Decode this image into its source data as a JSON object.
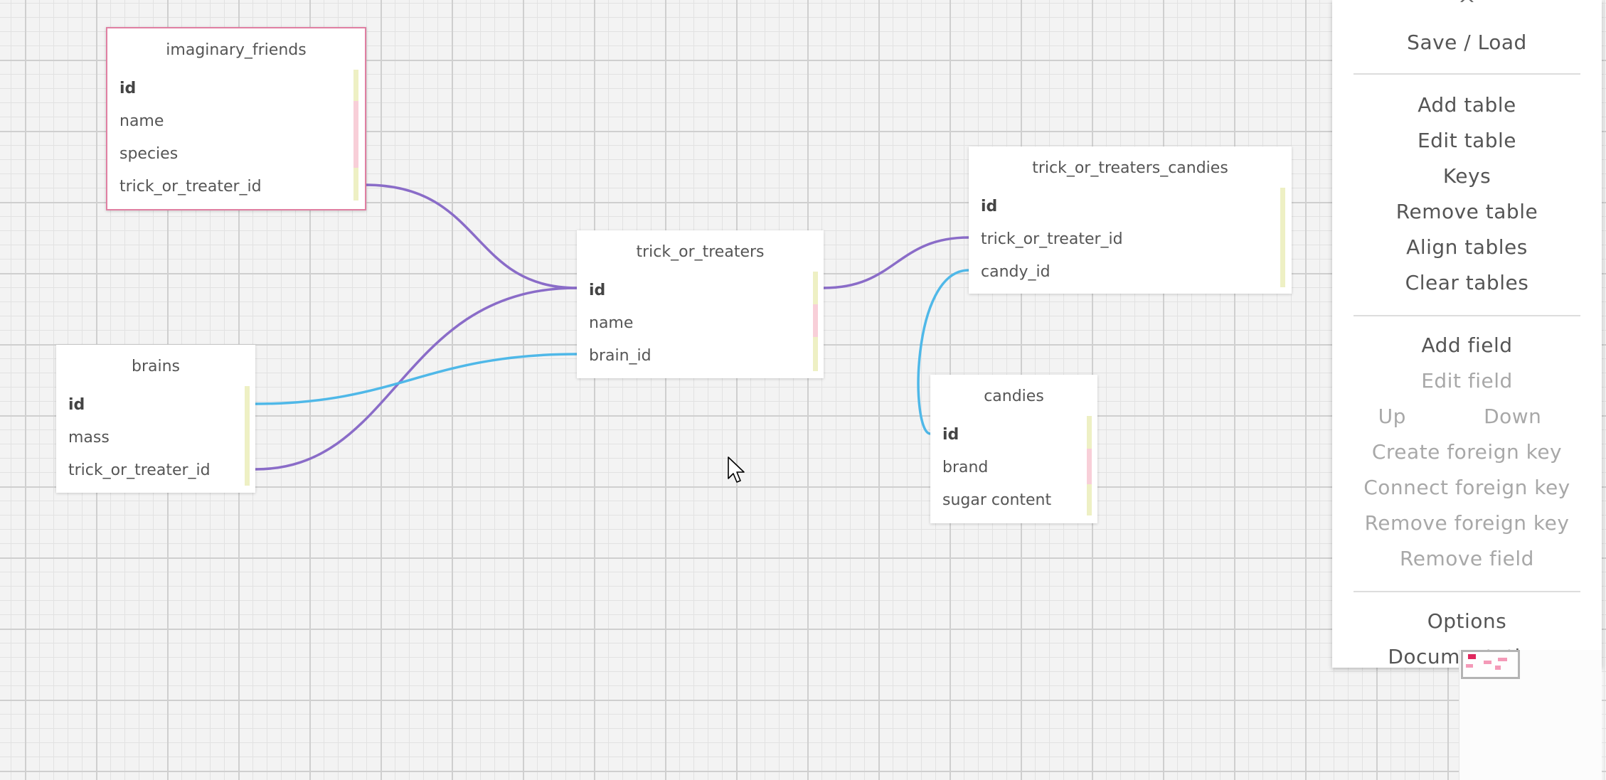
{
  "tables": [
    {
      "name": "imaginary_friends",
      "selected": true,
      "fields": [
        {
          "name": "id",
          "pk": true
        },
        {
          "name": "name",
          "pk": false
        },
        {
          "name": "species",
          "pk": false
        },
        {
          "name": "trick_or_treater_id",
          "pk": false
        }
      ]
    },
    {
      "name": "trick_or_treaters",
      "selected": false,
      "fields": [
        {
          "name": "id",
          "pk": true
        },
        {
          "name": "name",
          "pk": false
        },
        {
          "name": "brain_id",
          "pk": false
        }
      ]
    },
    {
      "name": "trick_or_treaters_candies",
      "selected": false,
      "fields": [
        {
          "name": "id",
          "pk": true
        },
        {
          "name": "trick_or_treater_id",
          "pk": false
        },
        {
          "name": "candy_id",
          "pk": false
        }
      ]
    },
    {
      "name": "brains",
      "selected": false,
      "fields": [
        {
          "name": "id",
          "pk": true
        },
        {
          "name": "mass",
          "pk": false
        },
        {
          "name": "trick_or_treater_id",
          "pk": false
        }
      ]
    },
    {
      "name": "candies",
      "selected": false,
      "fields": [
        {
          "name": "id",
          "pk": true
        },
        {
          "name": "brand",
          "pk": false
        },
        {
          "name": "sugar content",
          "pk": false
        }
      ]
    }
  ],
  "relations": [
    {
      "from": "imaginary_friends.trick_or_treater_id",
      "to": "trick_or_treaters.id",
      "color": "#8a6cc8"
    },
    {
      "from": "brains.trick_or_treater_id",
      "to": "trick_or_treaters.id",
      "color": "#8a6cc8"
    },
    {
      "from": "brains.id",
      "to": "trick_or_treaters.brain_id",
      "color": "#4fb8e8"
    },
    {
      "from": "trick_or_treaters.id",
      "to": "trick_or_treaters_candies.trick_or_treater_id",
      "color": "#8a6cc8"
    },
    {
      "from": "candies.id",
      "to": "trick_or_treaters_candies.candy_id",
      "color": "#4fb8e8"
    }
  ],
  "menu": {
    "collapse_icon": "chevron-up-icon",
    "collapse_glyph": "^",
    "save_load": "Save / Load",
    "table_section": {
      "add_table": "Add table",
      "edit_table": "Edit table",
      "keys": "Keys",
      "remove_table": "Remove table",
      "align_tables": "Align tables",
      "clear_tables": "Clear tables"
    },
    "field_section": {
      "add_field": "Add field",
      "edit_field": "Edit field",
      "up": "Up",
      "down": "Down",
      "create_foreign_key": "Create foreign key",
      "connect_foreign_key": "Connect foreign key",
      "remove_foreign_key": "Remove foreign key",
      "remove_field": "Remove field"
    },
    "options": "Options",
    "documentation": "Documentation"
  },
  "colors": {
    "fk_purple": "#8a6cc8",
    "fk_blue": "#4fb8e8",
    "selected_border": "#e07fa2",
    "minimap_selected": "#e0285e",
    "minimap_table": "#f49ab8"
  }
}
